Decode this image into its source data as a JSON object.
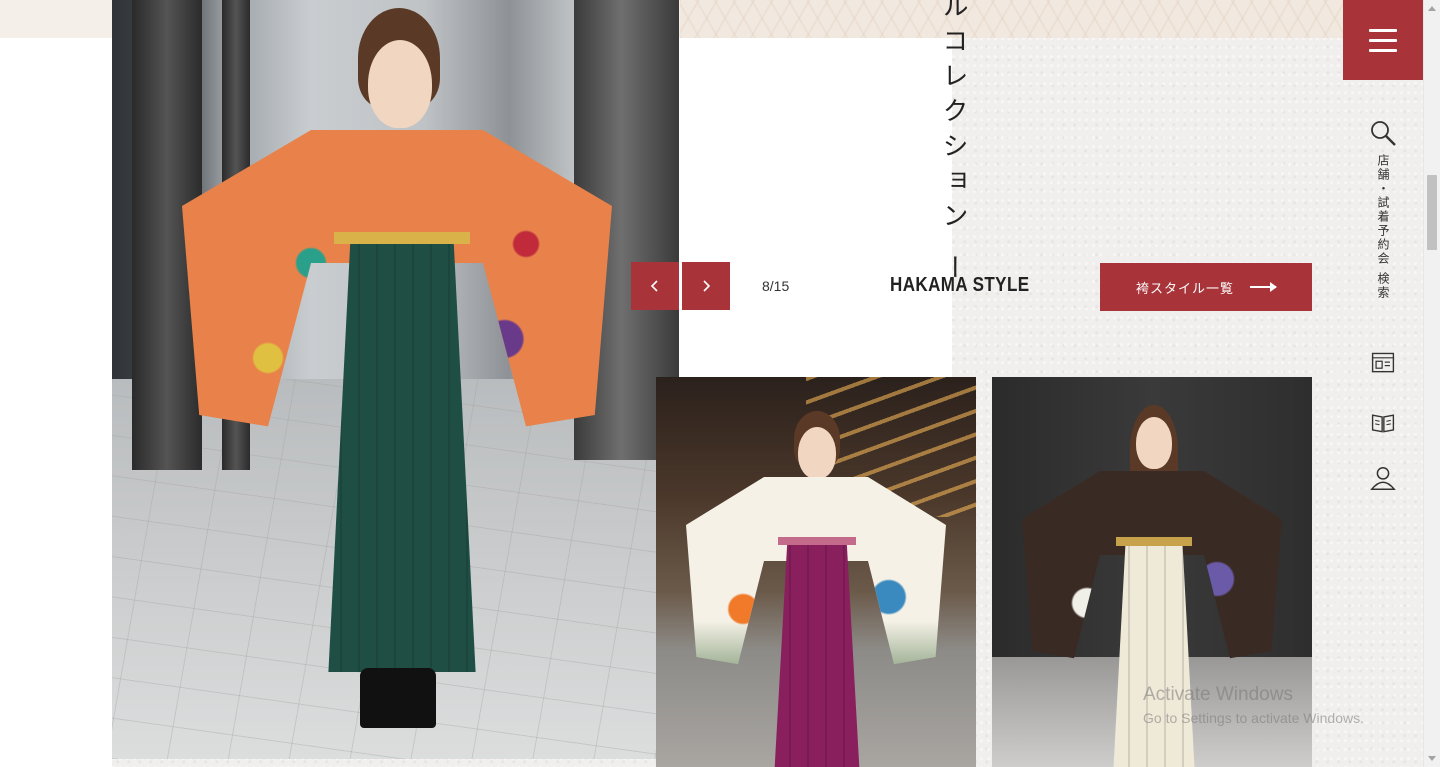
{
  "collection": {
    "vertical_title": "ルコレクション ー"
  },
  "slider": {
    "counter": "8/15",
    "style_title": "HAKAMA STYLE",
    "list_button_label": "袴スタイル一覧"
  },
  "sidebar": {
    "store_search_label": "店舗・試着予約会 検索"
  },
  "watermark": {
    "line1": "Activate Windows",
    "line2": "Go to Settings to activate Windows."
  },
  "colors": {
    "accent": "#a8343a",
    "background": "#f1efed"
  },
  "icons": [
    "menu-icon",
    "search-icon",
    "catalog-icon",
    "book-icon",
    "user-icon",
    "chevron-left-icon",
    "chevron-right-icon",
    "arrow-right-icon"
  ]
}
